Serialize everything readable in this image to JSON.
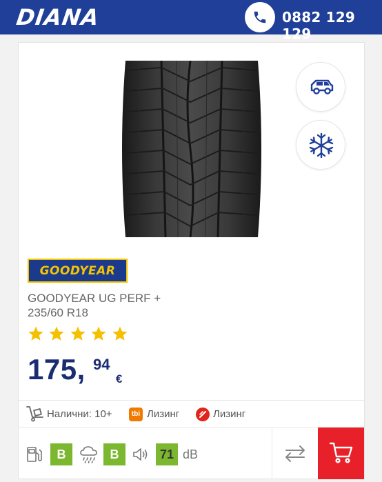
{
  "header": {
    "logo_text": "DIANA",
    "phone_icon": "phone-icon",
    "phone_number": "0882 129 129"
  },
  "product": {
    "image_icon": "tire-tread-image",
    "vehicle_icon": "suv-icon",
    "season_icon": "snowflake-icon",
    "brand_logo_text": "GOODYEAR",
    "name_line1": "GOODYEAR UG PERF +",
    "name_line2": "235/60 R18",
    "rating": 5,
    "rating_max": 5,
    "price_whole": "175,",
    "price_decimals": "94",
    "currency": "€"
  },
  "availability": {
    "text": "Налични: 10+",
    "leasing": [
      {
        "logo_text": "tbi",
        "label": "Лизинг"
      },
      {
        "logo_icon": "unicredit-logo-icon",
        "label": "Лизинг"
      }
    ]
  },
  "eu_label": {
    "fuel_grade": "B",
    "wet_grade": "B",
    "noise_value": "71",
    "noise_unit": "dB"
  },
  "colors": {
    "header_bg": "#1f3f99",
    "price": "#1b2c73",
    "star": "#f5c000",
    "grade": "#7cb82f",
    "cart": "#e8202a"
  }
}
